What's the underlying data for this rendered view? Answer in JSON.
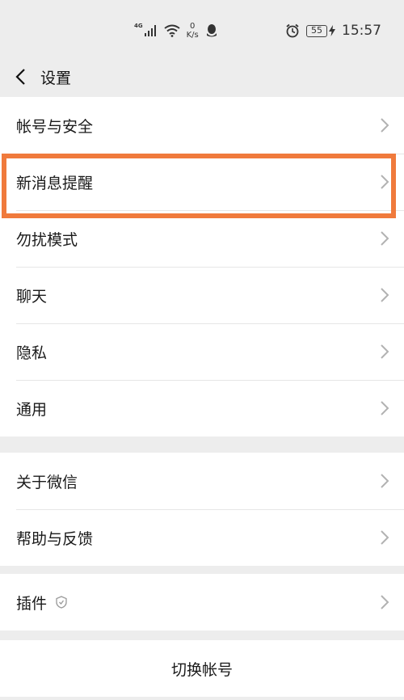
{
  "status_bar": {
    "network_label": "4G",
    "speed_value": "0",
    "speed_unit": "K/s",
    "battery": "55",
    "time": "15:57",
    "icons": [
      "signal-icon",
      "wifi-icon",
      "qq-icon",
      "alarm-icon",
      "battery-icon",
      "charging-icon"
    ]
  },
  "header": {
    "title": "设置",
    "back_icon": "back-chevron-icon"
  },
  "groups": [
    {
      "items": [
        {
          "label": "帐号与安全"
        },
        {
          "label": "新消息提醒",
          "highlighted": true
        },
        {
          "label": "勿扰模式"
        },
        {
          "label": "聊天"
        },
        {
          "label": "隐私"
        },
        {
          "label": "通用"
        }
      ]
    },
    {
      "items": [
        {
          "label": "关于微信"
        },
        {
          "label": "帮助与反馈"
        }
      ]
    },
    {
      "items": [
        {
          "label": "插件",
          "badge": "shield-icon"
        }
      ]
    }
  ],
  "footer": {
    "switch_account": "切换帐号"
  },
  "colors": {
    "background": "#ededed",
    "row_background": "#ffffff",
    "highlight": "#f07a3c",
    "chevron": "#b2b2b2"
  }
}
